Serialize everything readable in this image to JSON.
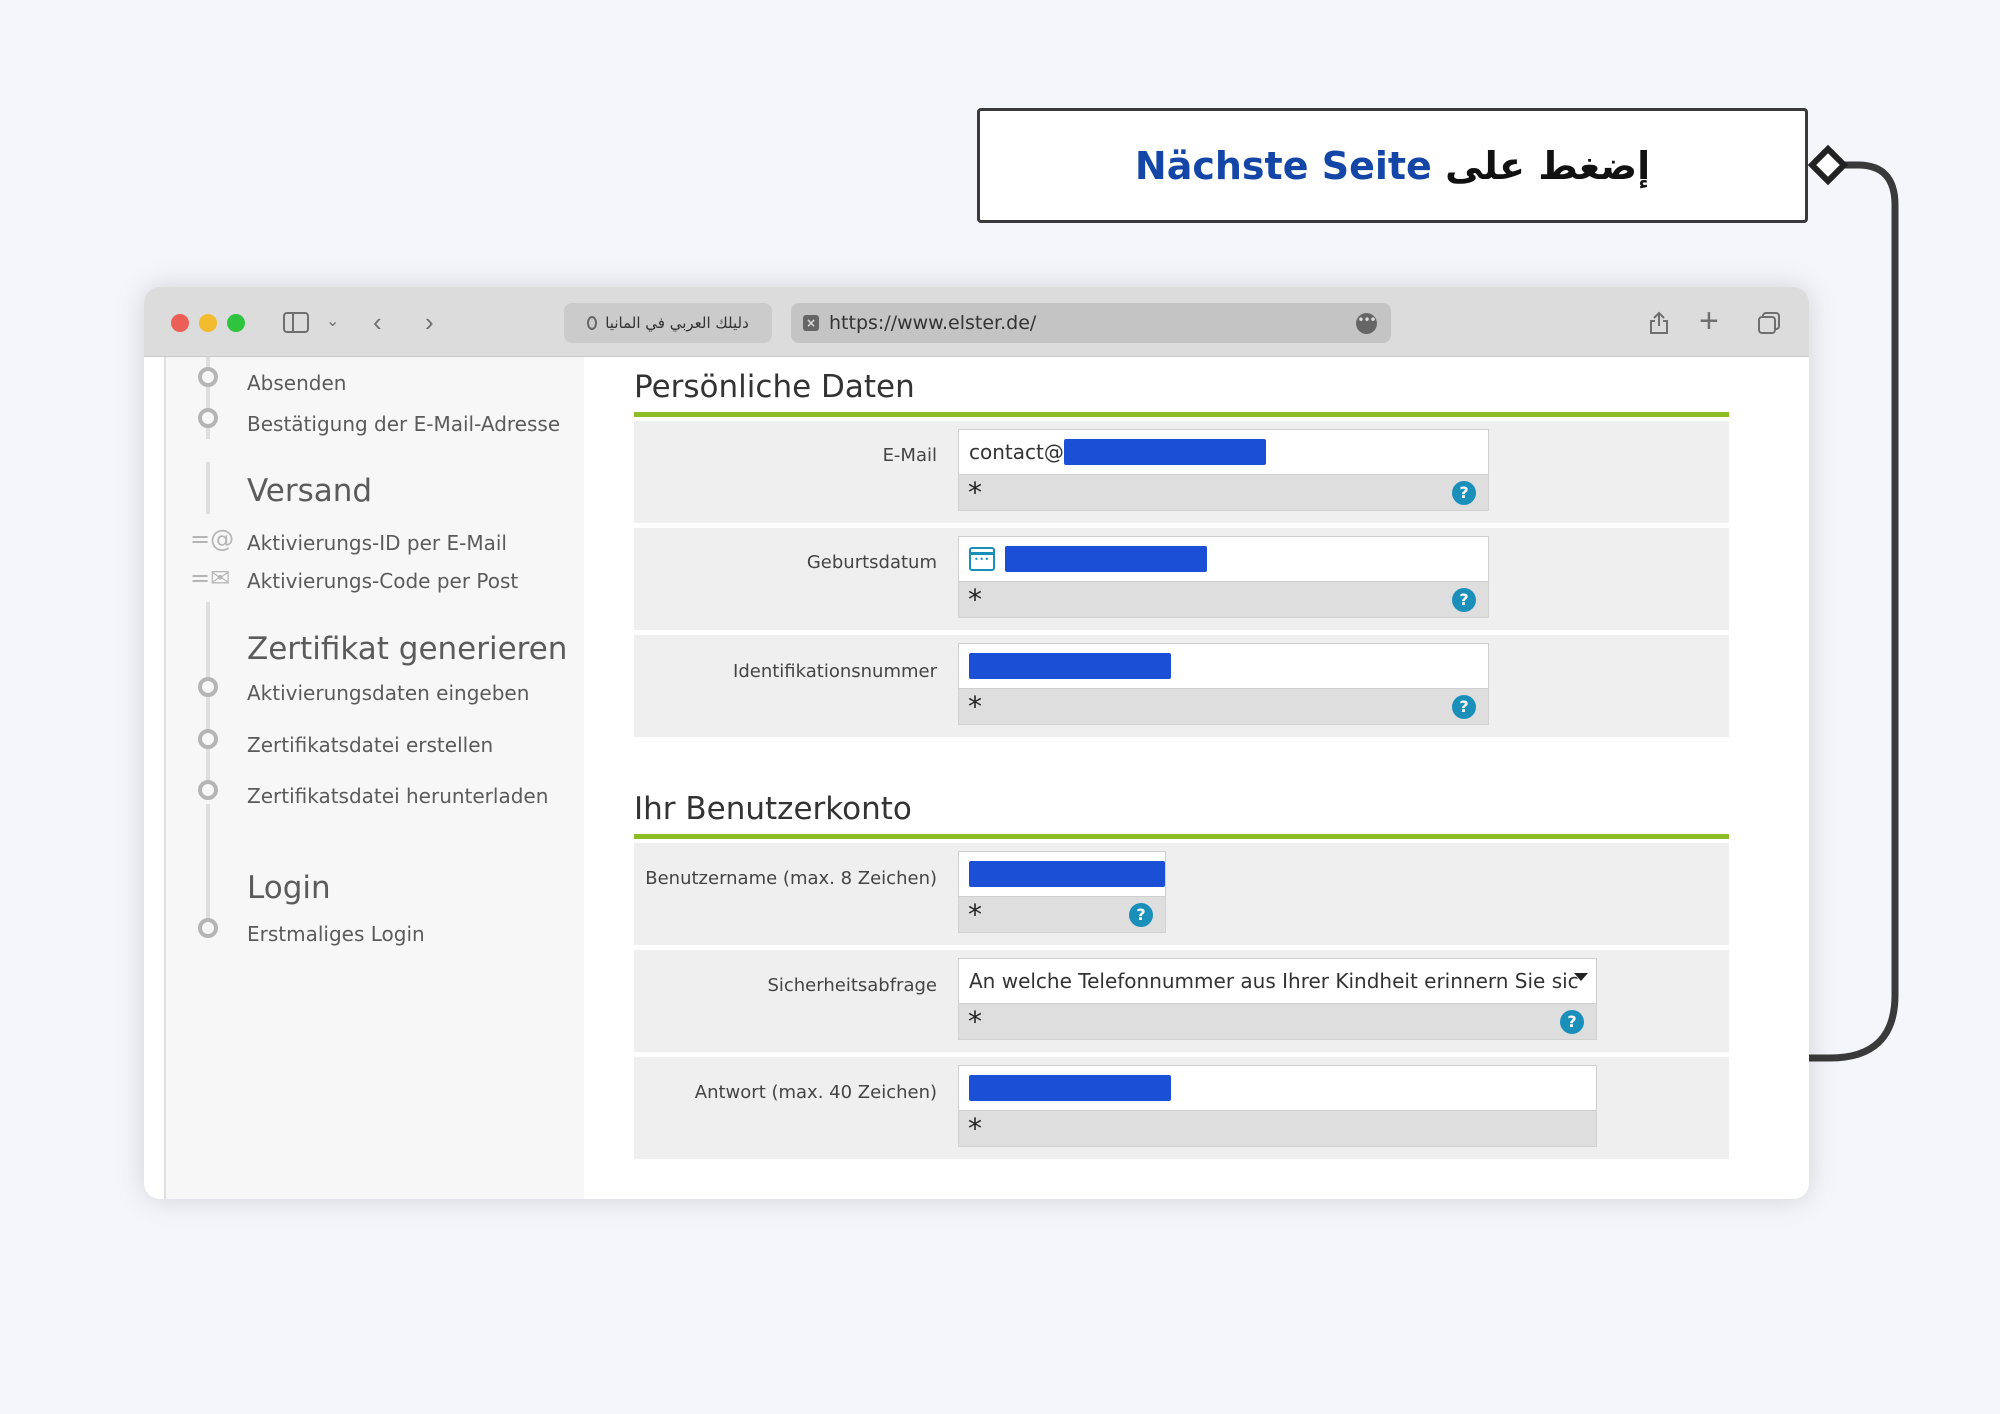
{
  "callout": {
    "prefix_ar": "إضغط على",
    "button_name": "Nächste Seite"
  },
  "browser": {
    "tab_title": "دليلك العربي في المانيا",
    "url": "https://www.elster.de/"
  },
  "sidebar": {
    "top_steps": [
      "Absenden",
      "Bestätigung der E-Mail-Adresse"
    ],
    "sections": [
      {
        "heading": "Versand",
        "items": [
          "Aktivierungs-ID per E-Mail",
          "Aktivierungs-Code per Post"
        ]
      },
      {
        "heading": "Zertifikat generieren",
        "items": [
          "Aktivierungsdaten eingeben",
          "Zertifikatsdatei erstellen",
          "Zertifikatsdatei herunterladen"
        ]
      },
      {
        "heading": "Login",
        "items": [
          "Erstmaliges Login"
        ]
      }
    ]
  },
  "form": {
    "personal": {
      "title": "Persönliche Daten",
      "email_label": "E-Mail",
      "email_value": "contact@",
      "birth_label": "Geburtsdatum",
      "id_label": "Identifikationsnummer"
    },
    "account": {
      "title": "Ihr Benutzerkonto",
      "username_label": "Benutzername (max. 8 Zeichen)",
      "security_label": "Sicherheitsabfrage",
      "security_value": "An welche Telefonnummer aus Ihrer Kindheit erinnern Sie sic",
      "answer_label": "Antwort (max. 40 Zeichen)"
    },
    "required_mark": "*",
    "help_mark": "?"
  },
  "colors": {
    "accent_green": "#8cbd22",
    "help_blue": "#1a8fb9",
    "redaction_blue": "#1a4fd6",
    "callout_blue": "#1346a6"
  }
}
